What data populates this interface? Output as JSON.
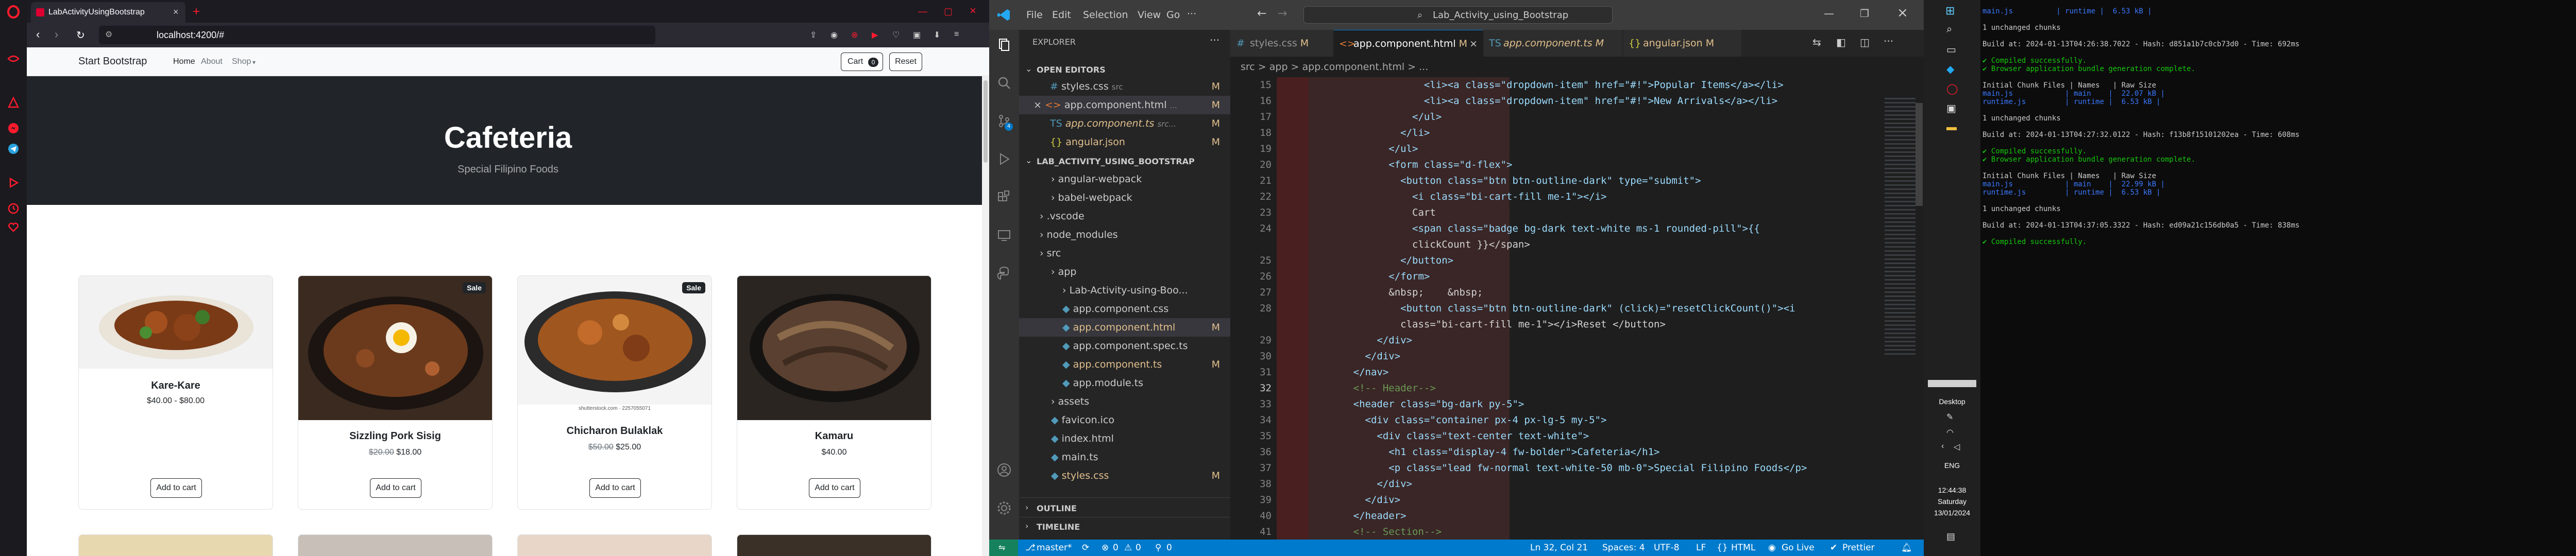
{
  "browser": {
    "tab_title": "LabActivityUsingBootstrap",
    "url": "localhost:4200/#"
  },
  "site": {
    "brand": "Start Bootstrap",
    "nav": [
      "Home",
      "About",
      "Shop"
    ],
    "cart_label": "Cart",
    "cart_count": "0",
    "reset_label": "Reset",
    "hero_title": "Cafeteria",
    "hero_subtitle": "Special Filipino Foods",
    "products": [
      {
        "name": "Kare-Kare",
        "price": "$40.00 - $80.00",
        "old_price": "",
        "sale": false,
        "button": "Add to cart"
      },
      {
        "name": "Sizzling Pork Sisig",
        "price": "$18.00",
        "old_price": "$20.00",
        "sale": true,
        "sale_label": "Sale",
        "button": "Add to cart"
      },
      {
        "name": "Chicharon Bulaklak",
        "price": "$25.00",
        "old_price": "$50.00",
        "sale": true,
        "sale_label": "Sale",
        "button": "Add to cart"
      },
      {
        "name": "Kamaru",
        "price": "$40.00",
        "old_price": "",
        "sale": false,
        "button": "Add to cart"
      }
    ],
    "image_caption": "shutterstock.com · 2257055071"
  },
  "vscode": {
    "title": "Lab_Activity_using_Bootstrap",
    "menu": [
      "File",
      "Edit",
      "Selection",
      "View",
      "Go"
    ],
    "explorer_label": "EXPLORER",
    "open_editors_label": "OPEN EDITORS",
    "open_editors": [
      {
        "name": "styles.css",
        "path": "src",
        "mark": "M"
      },
      {
        "name": "app.component.html",
        "path": "...",
        "mark": "M"
      },
      {
        "name": "app.component.ts",
        "path": "src...",
        "mark": "M"
      },
      {
        "name": "angular.json",
        "path": "",
        "mark": "M"
      }
    ],
    "project_label": "LAB_ACTIVITY_USING_BOOTSTRAP",
    "tree": [
      {
        "name": "angular-webpack",
        "type": "folder",
        "depth": 1
      },
      {
        "name": "babel-webpack",
        "type": "folder",
        "depth": 1
      },
      {
        "name": ".vscode",
        "type": "folder",
        "depth": 0
      },
      {
        "name": "node_modules",
        "type": "folder",
        "depth": 0
      },
      {
        "name": "src",
        "type": "folder",
        "depth": 0
      },
      {
        "name": "app",
        "type": "folder",
        "depth": 1
      },
      {
        "name": "Lab-Activity-using-Boo...",
        "type": "folder",
        "depth": 2
      },
      {
        "name": "app.component.css",
        "type": "file",
        "depth": 2
      },
      {
        "name": "app.component.html",
        "type": "file",
        "depth": 2,
        "mark": "M"
      },
      {
        "name": "app.component.spec.ts",
        "type": "file",
        "depth": 2
      },
      {
        "name": "app.component.ts",
        "type": "file",
        "depth": 2,
        "mark": "M"
      },
      {
        "name": "app.module.ts",
        "type": "file",
        "depth": 2
      },
      {
        "name": "assets",
        "type": "folder",
        "depth": 1
      },
      {
        "name": "favicon.ico",
        "type": "file",
        "depth": 1
      },
      {
        "name": "index.html",
        "type": "file",
        "depth": 1
      },
      {
        "name": "main.ts",
        "type": "file",
        "depth": 1
      },
      {
        "name": "styles.css",
        "type": "file",
        "depth": 1,
        "mark": "M"
      }
    ],
    "outline_label": "OUTLINE",
    "timeline_label": "TIMELINE",
    "tabs": [
      {
        "name": "styles.css",
        "mark": "M"
      },
      {
        "name": "app.component.html",
        "mark": "M",
        "active": true
      },
      {
        "name": "app.component.ts",
        "mark": "M"
      },
      {
        "name": "angular.json",
        "mark": "M"
      }
    ],
    "breadcrumb": "src > app > app.component.html > ...",
    "code_lines": [
      {
        "n": "15",
        "t": "                  <li><a class=\"dropdown-item\" href=\"#!\">Popular Items</a></li>"
      },
      {
        "n": "16",
        "t": "                  <li><a class=\"dropdown-item\" href=\"#!\">New Arrivals</a></li>"
      },
      {
        "n": "17",
        "t": "                </ul>"
      },
      {
        "n": "18",
        "t": "              </li>"
      },
      {
        "n": "19",
        "t": "            </ul>"
      },
      {
        "n": "20",
        "t": "            <form class=\"d-flex\">"
      },
      {
        "n": "21",
        "t": "              <button class=\"btn btn-outline-dark\" type=\"submit\">"
      },
      {
        "n": "22",
        "t": "                <i class=\"bi-cart-fill me-1\"></i>"
      },
      {
        "n": "23",
        "t": "                Cart"
      },
      {
        "n": "24",
        "t": "                <span class=\"badge bg-dark text-white ms-1 rounded-pill\">{{"
      },
      {
        "n": "",
        "t": "                clickCount }}</span>"
      },
      {
        "n": "25",
        "t": "              </button>"
      },
      {
        "n": "26",
        "t": "            </form>"
      },
      {
        "n": "27",
        "t": "            &nbsp;    &nbsp;"
      },
      {
        "n": "28",
        "t": "              <button class=\"btn btn-outline-dark\" (click)=\"resetClickCount()\"><i"
      },
      {
        "n": "",
        "t": "              class=\"bi-cart-fill me-1\"></i>Reset </button>"
      },
      {
        "n": "29",
        "t": "          </div>"
      },
      {
        "n": "30",
        "t": "        </div>"
      },
      {
        "n": "31",
        "t": "      </nav>"
      },
      {
        "n": "32",
        "t": "      <!-- Header-->"
      },
      {
        "n": "33",
        "t": "      <header class=\"bg-dark py-5\">"
      },
      {
        "n": "34",
        "t": "        <div class=\"container px-4 px-lg-5 my-5\">"
      },
      {
        "n": "35",
        "t": "          <div class=\"text-center text-white\">"
      },
      {
        "n": "36",
        "t": "            <h1 class=\"display-4 fw-bolder\">Cafeteria</h1>"
      },
      {
        "n": "37",
        "t": "            <p class=\"lead fw-normal text-white-50 mb-0\">Special Filipino Foods</p>"
      },
      {
        "n": "38",
        "t": "          </div>"
      },
      {
        "n": "39",
        "t": "        </div>"
      },
      {
        "n": "40",
        "t": "      </header>"
      },
      {
        "n": "41",
        "t": "      <!-- Section-->"
      }
    ],
    "status": {
      "branch": "master*",
      "errors": "0",
      "warnings": "0",
      "ports": "0",
      "position": "Ln 32, Col 21",
      "spaces": "Spaces: 4",
      "encoding": "UTF-8",
      "eol": "LF",
      "language": "HTML",
      "golive": "Go Live",
      "prettier": "Prettier"
    }
  },
  "taskbar": {
    "desktop_label": "Desktop",
    "lang": "ENG",
    "time": "12:44:38",
    "day": "Saturday",
    "date": "13/01/2024"
  },
  "terminal": {
    "lines": [
      "main.js          | runtime |  6.53 kB |",
      "",
      "1 unchanged chunks",
      "",
      "Build at: 2024-01-13T04:26:38.7022 - Hash: d851a1b7c0cb73d0 - Time: 692ms",
      "",
      "✔ Compiled successfully.",
      "✔ Browser application bundle generation complete.",
      "",
      "Initial Chunk Files | Names   | Raw Size",
      "main.js            | main    |  22.07 kB |",
      "runtime.js         | runtime |  6.53 kB |",
      "",
      "1 unchanged chunks",
      "",
      "Build at: 2024-01-13T04:27:32.0122 - Hash: f13b8f15101202ea - Time: 608ms",
      "",
      "✔ Compiled successfully.",
      "✔ Browser application bundle generation complete.",
      "",
      "Initial Chunk Files | Names   | Raw Size",
      "main.js            | main    |  22.99 kB |",
      "runtime.js         | runtime |  6.53 kB |",
      "",
      "1 unchanged chunks",
      "",
      "Build at: 2024-01-13T04:37:05.3322 - Hash: ed09a21c156db0a5 - Time: 838ms",
      "",
      "✔ Compiled successfully."
    ]
  },
  "colors": {
    "vscode_accent": "#007acc",
    "opera_red": "#ff1b2d",
    "hero_bg": "#212529"
  }
}
